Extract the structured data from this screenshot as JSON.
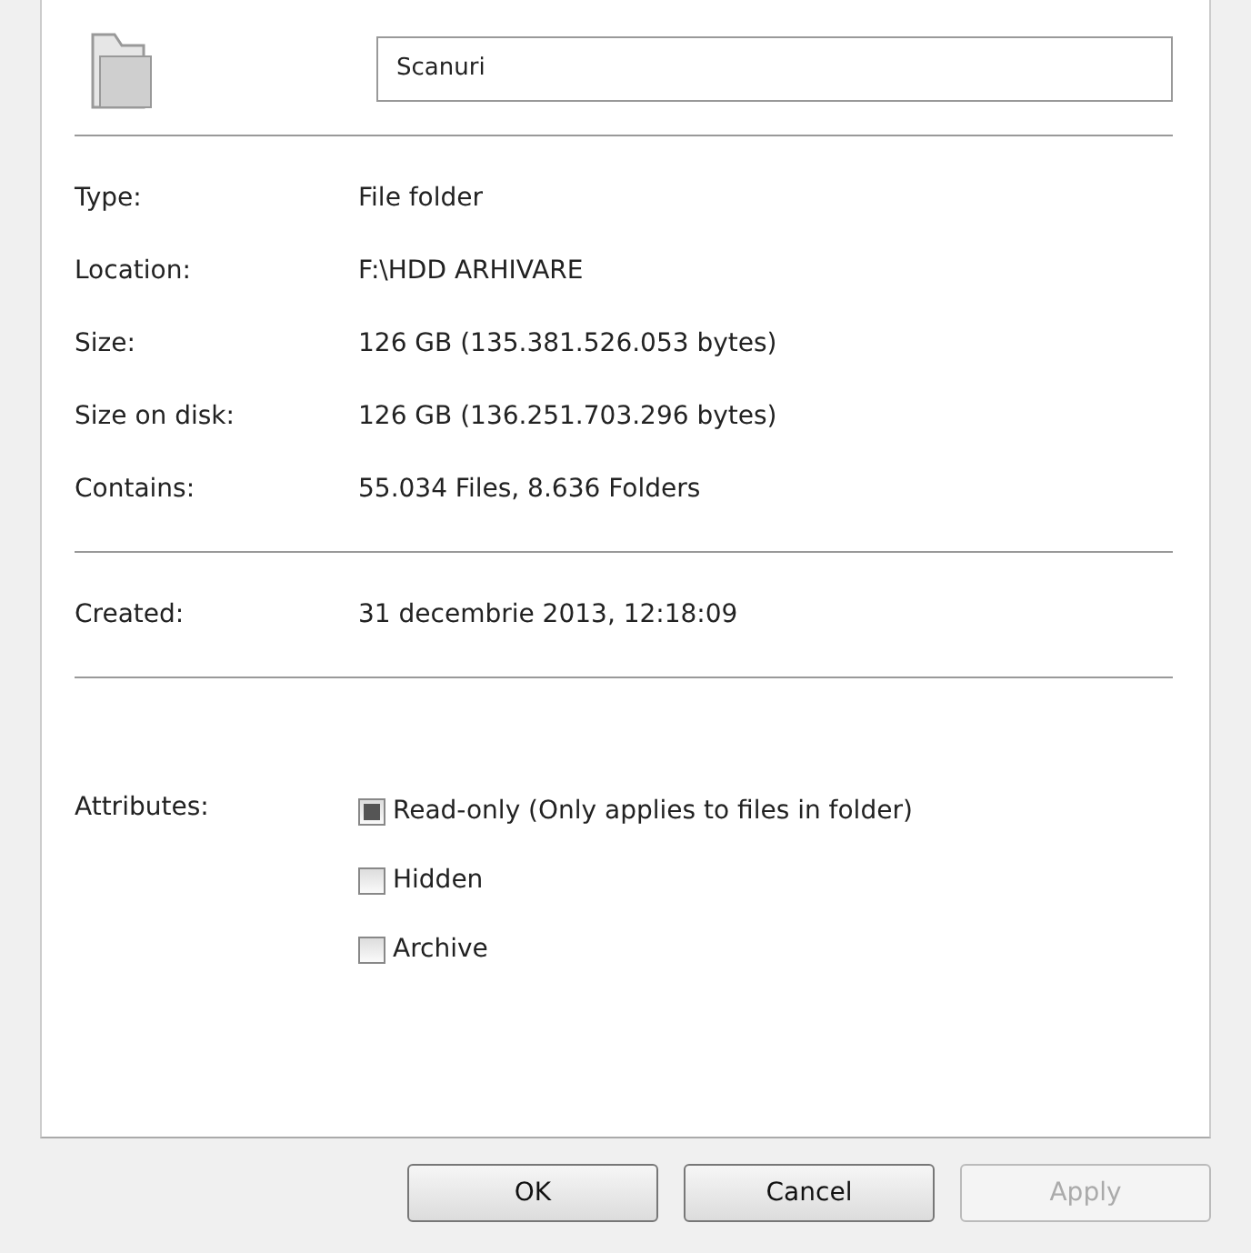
{
  "name_field": {
    "value": "Scanuri"
  },
  "groups": [
    [
      {
        "label": "Type:",
        "value": "File folder"
      },
      {
        "label": "Location:",
        "value": "F:\\HDD ARHIVARE"
      },
      {
        "label": "Size:",
        "value": "126 GB (135.381.526.053 bytes)"
      },
      {
        "label": "Size on disk:",
        "value": "126 GB (136.251.703.296 bytes)"
      },
      {
        "label": "Contains:",
        "value": "55.034 Files, 8.636 Folders"
      }
    ],
    [
      {
        "label": "Created:",
        "value": "31 decembrie 2013, 12:18:09"
      }
    ]
  ],
  "attributes": {
    "label": "Attributes:",
    "items": [
      {
        "label": "Read-only (Only applies to files in folder)",
        "checked": false,
        "indeterminate": true
      },
      {
        "label": "Hidden",
        "checked": false,
        "indeterminate": false
      },
      {
        "label": "Archive",
        "checked": false,
        "indeterminate": false
      }
    ]
  },
  "buttons": [
    {
      "label": "OK",
      "disabled": false
    },
    {
      "label": "Cancel",
      "disabled": false
    },
    {
      "label": "Apply",
      "disabled": true
    }
  ]
}
